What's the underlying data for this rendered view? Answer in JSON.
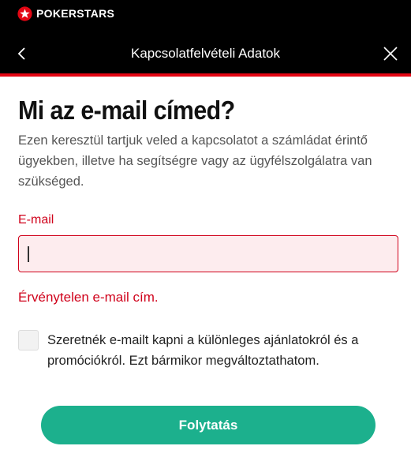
{
  "brand": {
    "name": "POKERSTARS",
    "color": "#e30613"
  },
  "header": {
    "title": "Kapcsolatfelvételi Adatok",
    "back_icon": "chevron-left-icon",
    "close_icon": "close-icon"
  },
  "main": {
    "heading": "Mi az e-mail címed?",
    "subtitle": "Ezen keresztül tartjuk veled a kapcsolatot a számládat érintő ügyekben, illetve ha segítségre vagy az ügyfélszolgálatra van szükséged.",
    "email": {
      "label": "E-mail",
      "value": "",
      "placeholder": "",
      "error": "Érvénytelen e-mail cím."
    },
    "marketing_opt_in": {
      "checked": false,
      "label": "Szeretnék e-mailt kapni a különleges ajánlatokról és a promóciókról. Ezt bármikor megváltoztathatom."
    },
    "continue_label": "Folytatás"
  },
  "colors": {
    "accent_red": "#e30613",
    "error": "#d0021b",
    "error_bg": "#fdecee",
    "button": "#1cb08d"
  }
}
